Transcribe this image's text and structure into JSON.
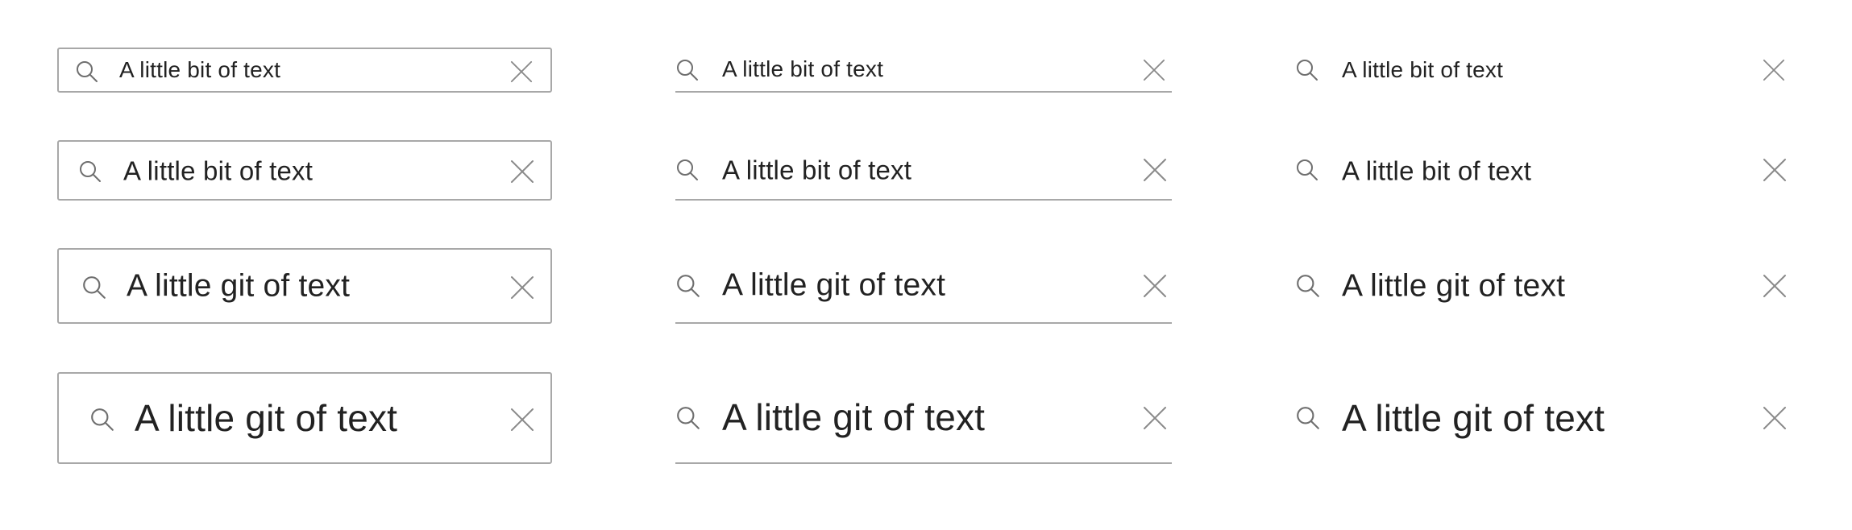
{
  "variants": {
    "boxed": [
      {
        "size": "small",
        "value": "A little bit of text",
        "search_icon": "search-icon",
        "clear_icon": "close-icon"
      },
      {
        "size": "medium",
        "value": "A little bit of text",
        "search_icon": "search-icon",
        "clear_icon": "close-icon"
      },
      {
        "size": "large",
        "value": "A little git of text",
        "search_icon": "search-icon",
        "clear_icon": "close-icon"
      },
      {
        "size": "x-large",
        "value": "A little git of text",
        "search_icon": "search-icon",
        "clear_icon": "close-icon"
      }
    ],
    "underlined": [
      {
        "size": "small",
        "value": "A little bit of text",
        "search_icon": "search-icon",
        "clear_icon": "close-icon"
      },
      {
        "size": "medium",
        "value": "A little bit of text",
        "search_icon": "search-icon",
        "clear_icon": "close-icon"
      },
      {
        "size": "large",
        "value": "A little git of text",
        "search_icon": "search-icon",
        "clear_icon": "close-icon"
      },
      {
        "size": "x-large",
        "value": "A little git of text",
        "search_icon": "search-icon",
        "clear_icon": "close-icon"
      }
    ],
    "borderless": [
      {
        "size": "small",
        "value": "A little bit of text",
        "search_icon": "search-icon",
        "clear_icon": "close-icon"
      },
      {
        "size": "medium",
        "value": "A little bit of text",
        "search_icon": "search-icon",
        "clear_icon": "close-icon"
      },
      {
        "size": "large",
        "value": "A little git of text",
        "search_icon": "search-icon",
        "clear_icon": "close-icon"
      },
      {
        "size": "x-large",
        "value": "A little git of text",
        "search_icon": "search-icon",
        "clear_icon": "close-icon"
      }
    ]
  },
  "colors": {
    "border": "#a8a8a8",
    "text": "#222222",
    "icon": "#6f6f6f",
    "clear_icon": "#8a8a8a"
  }
}
